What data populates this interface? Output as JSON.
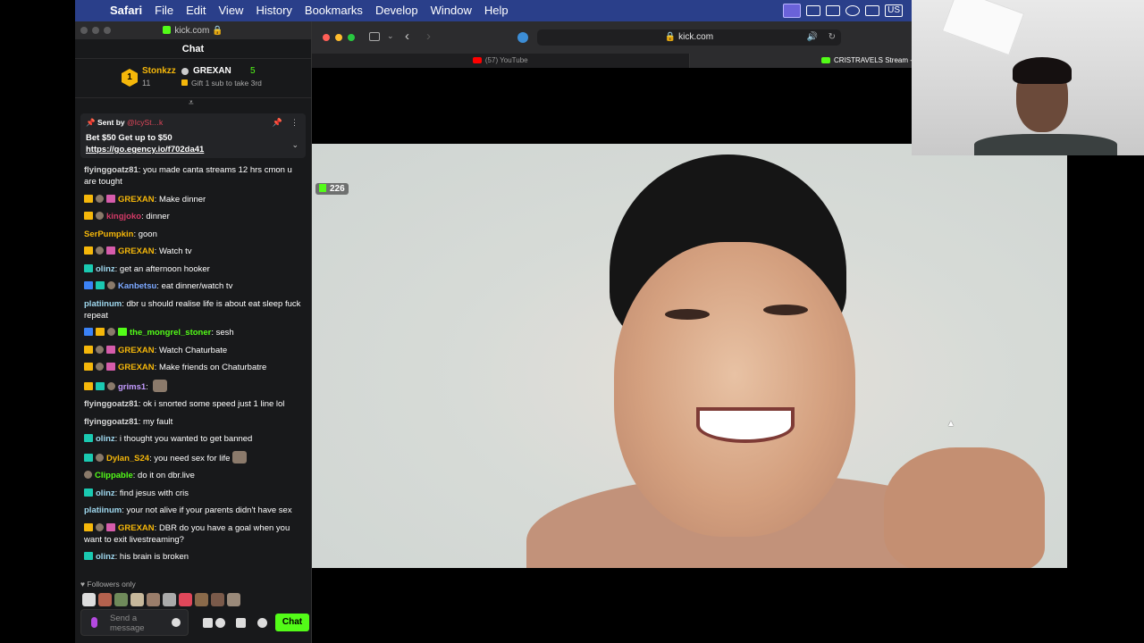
{
  "menubar": {
    "app": "Safari",
    "items": [
      "File",
      "Edit",
      "View",
      "History",
      "Bookmarks",
      "Develop",
      "Window",
      "Help"
    ],
    "input_source": "US"
  },
  "chat_window": {
    "url": "kick.com",
    "title": "Chat",
    "leaderboard": {
      "first": {
        "rank": "1",
        "name": "Stonkzz",
        "count": "11"
      },
      "second": {
        "name": "GREXAN",
        "count": "5"
      },
      "gift_text": "Gift 1 sub to take 3rd"
    },
    "pinned": {
      "sent_by_label": "Sent by",
      "sent_by_user": "@IcySt…k",
      "message": "Bet $50 Get up to $50",
      "link": "https://go.egency.io/f702da41"
    },
    "messages": [
      {
        "user": "flyinggoatz81",
        "color": "#d9d9d9",
        "text": "you made canta streams 12 hrs cmon u are tought",
        "badges": []
      },
      {
        "user": "GREXAN",
        "color": "#f5b70a",
        "text": "Make dinner",
        "badges": [
          "crown",
          "avatar",
          "gift"
        ]
      },
      {
        "user": "kingjoko",
        "color": "#d23a66",
        "text": "dinner",
        "badges": [
          "crown",
          "avatar"
        ]
      },
      {
        "user": "SerPumpkin",
        "color": "#f5b70a",
        "text": "goon",
        "badges": []
      },
      {
        "user": "GREXAN",
        "color": "#f5b70a",
        "text": "Watch tv",
        "badges": [
          "crown",
          "avatar",
          "gift"
        ]
      },
      {
        "user": "olinz",
        "color": "#9fd8ef",
        "text": "get an afternoon hooker",
        "badges": [
          "sub"
        ]
      },
      {
        "user": "Kanbetsu",
        "color": "#7ba8ff",
        "text": "eat dinner/watch tv",
        "badges": [
          "verified",
          "sub",
          "avatar"
        ]
      },
      {
        "user": "platiinum",
        "color": "#9fd8ef",
        "text": "dbr u should realise life is about eat sleep fuck repeat",
        "badges": []
      },
      {
        "user": "the_mongrel_stoner",
        "color": "#53fc18",
        "text": "sesh",
        "badges": [
          "verified",
          "crown",
          "avatar",
          "green"
        ]
      },
      {
        "user": "GREXAN",
        "color": "#f5b70a",
        "text": "Watch Chaturbate",
        "badges": [
          "crown",
          "avatar",
          "gift"
        ]
      },
      {
        "user": "GREXAN",
        "color": "#f5b70a",
        "text": "Make friends on Chaturbatre",
        "badges": [
          "crown",
          "avatar",
          "gift"
        ]
      },
      {
        "user": "grims1",
        "color": "#c39bff",
        "text": "",
        "badges": [
          "crown",
          "sub",
          "avatar"
        ],
        "emote": true
      },
      {
        "user": "flyinggoatz81",
        "color": "#d9d9d9",
        "text": "ok i snorted some speed just 1 line lol",
        "badges": []
      },
      {
        "user": "flyinggoatz81",
        "color": "#d9d9d9",
        "text": "my fault",
        "badges": []
      },
      {
        "user": "olinz",
        "color": "#9fd8ef",
        "text": "i thought you wanted to get banned",
        "badges": [
          "sub"
        ]
      },
      {
        "user": "Dylan_S24",
        "color": "#f5b70a",
        "text": "you need sex for life",
        "badges": [
          "sub",
          "avatar"
        ],
        "emote": true
      },
      {
        "user": "Clippable",
        "color": "#53fc18",
        "text": "do it on dbr.live",
        "badges": [
          "avatar"
        ]
      },
      {
        "user": "olinz",
        "color": "#9fd8ef",
        "text": "find jesus with cris",
        "badges": [
          "sub"
        ]
      },
      {
        "user": "platiinum",
        "color": "#9fd8ef",
        "text": "your not alive if your parents didn't have sex",
        "badges": []
      },
      {
        "user": "GREXAN",
        "color": "#f5b70a",
        "text": "DBR do you have a goal when you want to exit livestreaming?",
        "badges": [
          "crown",
          "avatar",
          "gift"
        ]
      },
      {
        "user": "olinz",
        "color": "#9fd8ef",
        "text": "his brain is broken",
        "badges": [
          "sub"
        ]
      }
    ],
    "followers_only": "Followers only",
    "input_placeholder": "Send a message",
    "send_label": "Chat"
  },
  "safari": {
    "address": "kick.com",
    "tabs": [
      {
        "label": "(57) YouTube",
        "active": false
      },
      {
        "label": "CRISTRAVELS Stream - Watch",
        "active": true
      }
    ]
  },
  "stream": {
    "viewer_count": "226"
  }
}
